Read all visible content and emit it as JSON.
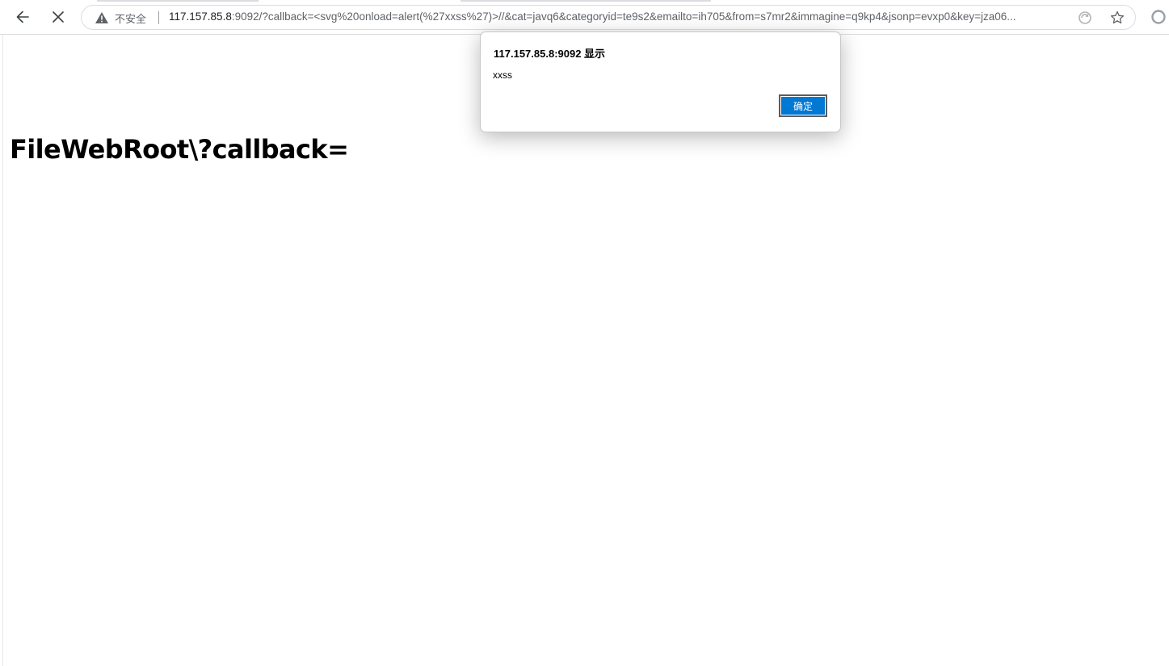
{
  "browser": {
    "security_label": "不安全",
    "url_host": "117.157.85.8",
    "url_rest": ":9092/?callback=<svg%20onload=alert(%27xxss%27)>//&cat=javq6&categoryid=te9s2&emailto=ih705&from=s7mr2&immagine=q9kp4&jsonp=evxp0&key=jza06...",
    "icons": {
      "back": "back-arrow-icon",
      "stop": "close-icon",
      "security": "warning-triangle-icon",
      "reader": "reader-mode-icon",
      "favorite": "star-icon",
      "extension": "profile-circle-icon"
    }
  },
  "page": {
    "heading": "FileWebRoot\\?callback="
  },
  "dialog": {
    "title": "117.157.85.8:9092 显示",
    "message": "xxss",
    "ok_label": "确定",
    "accent_color": "#0078d4"
  }
}
